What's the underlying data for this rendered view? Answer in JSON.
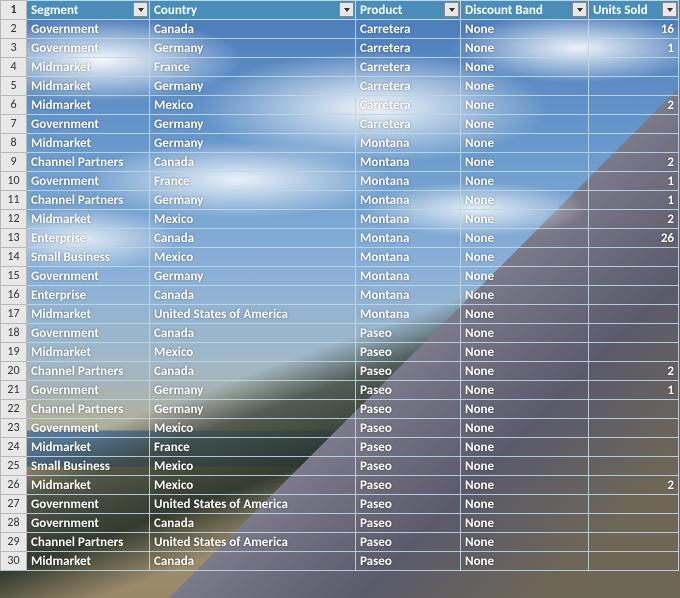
{
  "headers": {
    "segment": "Segment",
    "country": "Country",
    "product": "Product",
    "discount_band": "Discount Band",
    "units_sold": "Units Sold"
  },
  "rows": [
    {
      "n": 2,
      "segment": "Government",
      "country": "Canada",
      "product": "Carretera",
      "disc": "None",
      "units": "16"
    },
    {
      "n": 3,
      "segment": "Government",
      "country": "Germany",
      "product": "Carretera",
      "disc": "None",
      "units": "1"
    },
    {
      "n": 4,
      "segment": "Midmarket",
      "country": "France",
      "product": "Carretera",
      "disc": "None",
      "units": ""
    },
    {
      "n": 5,
      "segment": "Midmarket",
      "country": "Germany",
      "product": "Carretera",
      "disc": "None",
      "units": ""
    },
    {
      "n": 6,
      "segment": "Midmarket",
      "country": "Mexico",
      "product": "Carretera",
      "disc": "None",
      "units": "2"
    },
    {
      "n": 7,
      "segment": "Government",
      "country": "Germany",
      "product": "Carretera",
      "disc": "None",
      "units": ""
    },
    {
      "n": 8,
      "segment": "Midmarket",
      "country": "Germany",
      "product": "Montana",
      "disc": "None",
      "units": ""
    },
    {
      "n": 9,
      "segment": "Channel Partners",
      "country": "Canada",
      "product": "Montana",
      "disc": "None",
      "units": "2"
    },
    {
      "n": 10,
      "segment": "Government",
      "country": "France",
      "product": "Montana",
      "disc": "None",
      "units": "1"
    },
    {
      "n": 11,
      "segment": "Channel Partners",
      "country": "Germany",
      "product": "Montana",
      "disc": "None",
      "units": "1"
    },
    {
      "n": 12,
      "segment": "Midmarket",
      "country": "Mexico",
      "product": "Montana",
      "disc": "None",
      "units": "2"
    },
    {
      "n": 13,
      "segment": "Enterprise",
      "country": "Canada",
      "product": "Montana",
      "disc": "None",
      "units": "26"
    },
    {
      "n": 14,
      "segment": "Small Business",
      "country": "Mexico",
      "product": "Montana",
      "disc": "None",
      "units": ""
    },
    {
      "n": 15,
      "segment": "Government",
      "country": "Germany",
      "product": "Montana",
      "disc": "None",
      "units": ""
    },
    {
      "n": 16,
      "segment": "Enterprise",
      "country": "Canada",
      "product": "Montana",
      "disc": "None",
      "units": ""
    },
    {
      "n": 17,
      "segment": "Midmarket",
      "country": "United States of America",
      "product": "Montana",
      "disc": "None",
      "units": ""
    },
    {
      "n": 18,
      "segment": "Government",
      "country": "Canada",
      "product": "Paseo",
      "disc": "None",
      "units": ""
    },
    {
      "n": 19,
      "segment": "Midmarket",
      "country": "Mexico",
      "product": "Paseo",
      "disc": "None",
      "units": ""
    },
    {
      "n": 20,
      "segment": "Channel Partners",
      "country": "Canada",
      "product": "Paseo",
      "disc": "None",
      "units": "2"
    },
    {
      "n": 21,
      "segment": "Government",
      "country": "Germany",
      "product": "Paseo",
      "disc": "None",
      "units": "1"
    },
    {
      "n": 22,
      "segment": "Channel Partners",
      "country": "Germany",
      "product": "Paseo",
      "disc": "None",
      "units": ""
    },
    {
      "n": 23,
      "segment": "Government",
      "country": "Mexico",
      "product": "Paseo",
      "disc": "None",
      "units": ""
    },
    {
      "n": 24,
      "segment": "Midmarket",
      "country": "France",
      "product": "Paseo",
      "disc": "None",
      "units": ""
    },
    {
      "n": 25,
      "segment": "Small Business",
      "country": "Mexico",
      "product": "Paseo",
      "disc": "None",
      "units": ""
    },
    {
      "n": 26,
      "segment": "Midmarket",
      "country": "Mexico",
      "product": "Paseo",
      "disc": "None",
      "units": "2"
    },
    {
      "n": 27,
      "segment": "Government",
      "country": "United States of America",
      "product": "Paseo",
      "disc": "None",
      "units": ""
    },
    {
      "n": 28,
      "segment": "Government",
      "country": "Canada",
      "product": "Paseo",
      "disc": "None",
      "units": ""
    },
    {
      "n": 29,
      "segment": "Channel Partners",
      "country": "United States of America",
      "product": "Paseo",
      "disc": "None",
      "units": ""
    },
    {
      "n": 30,
      "segment": "Midmarket",
      "country": "Canada",
      "product": "Paseo",
      "disc": "None",
      "units": ""
    }
  ]
}
